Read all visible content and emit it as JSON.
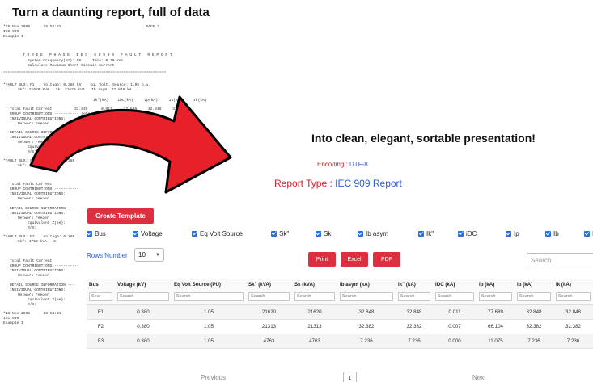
{
  "headline_top": "Turn a daunting report, full of data",
  "headline_right": "Into clean, elegant, sortable presentation!",
  "raw_report": [
    "*18 Nov 2008      15:51:23                                      PAGE 2",
    "IEC 909",
    "Example I",
    "T H R E E   P H A S E   I E C   6 0 9 0 9   F A U L T   R E P O R T",
    "System Frequency(Hz): 50     Tmin: 0.10 sec.",
    "Calculate Maximum Short-Circuit Current",
    "=========================================================================",
    "*FAULT BUS: F1    Voltage: 0.380 kV    Eq. Volt. Source: 1.05 p.u.",
    "Sk\": 21620 kVA   Sk: 21620 kVA   Ib asym: 32.848 kA",
    "Ik\"(kA)    iDC(kA)     ip(kA)     Ib(kA)     Ik(kA)",
    "Total Fault Current          32.848      0.011     77.689     32.848     32.848",
    "GROUP CONTRIBUTIONS ----------- referred to 0.380 kV",
    "INDIVIDUAL CONTRIBUTIONS:",
    "Network Feeder                                 689     32.848     32.848",
    "DETAIL SOURCE INFORMATION",
    "INDIVIDUAL CONTRIBUTIONS:",
    "Network Feeder                                     Status: MESHED, FAR",
    "Equivalen",
    "R/X:",
    "*FAULT BUS: F2    Voltage: 0.380",
    "Sk\": 21313 kVA",
    "Total Fault Current",
    "GROUP CONTRIBUTIONS -----------",
    "INDIVIDUAL CONTRIBUTIONS:",
    "Network Feeder",
    "DETAIL SOURCE INFORMATION ---",
    "INDIVIDUAL CONTRIBUTIONS:",
    "Network Feeder",
    "Equivalent Z(ee):",
    "R/X:",
    "*FAULT BUS: F3    Voltage: 0.380",
    "Sk\": 4763 kVA   S",
    "Total Fault Current",
    "GROUP CONTRIBUTIONS -----------",
    "INDIVIDUAL CONTRIBUTIONS:",
    "Network Feeder",
    "DETAIL SOURCE INFORMATION ---",
    "INDIVIDUAL CONTRIBUTIONS:",
    "Network Feeder",
    "Equivalent Z(ee):",
    "R/X:",
    "*18 Nov 2008      15:51:23",
    "IEC 909",
    "Example I"
  ],
  "encoding": {
    "label": "Encoding : ",
    "value": "UTF-8"
  },
  "report_type": {
    "label": "Report Type : ",
    "value": "IEC 909 Report"
  },
  "create_template_label": "Create Template",
  "column_toggles": [
    "Bus",
    "Voltage",
    "Eq Volt Source",
    "Sk\"",
    "Sk",
    "Ib asym",
    "Ik\"",
    "iDC",
    "Ip",
    "Ib",
    "Ik"
  ],
  "rows_number": {
    "label": "Rows Number",
    "value": "10"
  },
  "export_buttons": [
    "Print",
    "Excel",
    "PDF"
  ],
  "search_placeholder": "Search",
  "table": {
    "headers": [
      "Bus",
      "Voltage (kV)",
      "Eq Volt Source (PU)",
      "Sk\" (kVA)",
      "Sk (kVA)",
      "Ib asym (kA)",
      "Ik\" (kA)",
      "iDC (kA)",
      "Ip (kA)",
      "Ib (kA)",
      "Ik (kA)"
    ],
    "filter_placeholders": [
      "Sear",
      "Search",
      "Search",
      "Search",
      "Search",
      "Search",
      "Search",
      "Search",
      "Search",
      "Search",
      "Search"
    ],
    "rows": [
      [
        "F1",
        "0.380",
        "1.05",
        "21620",
        "21620",
        "32.848",
        "32.848",
        "0.011",
        "77.689",
        "32.848",
        "32.848"
      ],
      [
        "F2",
        "0.380",
        "1.05",
        "21313",
        "21313",
        "32.382",
        "32.382",
        "0.007",
        "66.104",
        "32.382",
        "32.382"
      ],
      [
        "F3",
        "0.380",
        "1.05",
        "4763",
        "4763",
        "7.236",
        "7.236",
        "0.000",
        "11.075",
        "7.236",
        "7.236"
      ]
    ]
  },
  "pagination": {
    "previous": "Previous",
    "page": "1",
    "next": "Next"
  },
  "colors": {
    "accent_red": "#dc2f3f",
    "link_blue": "#2a5bd7",
    "arrow_red": "#e8202a"
  }
}
